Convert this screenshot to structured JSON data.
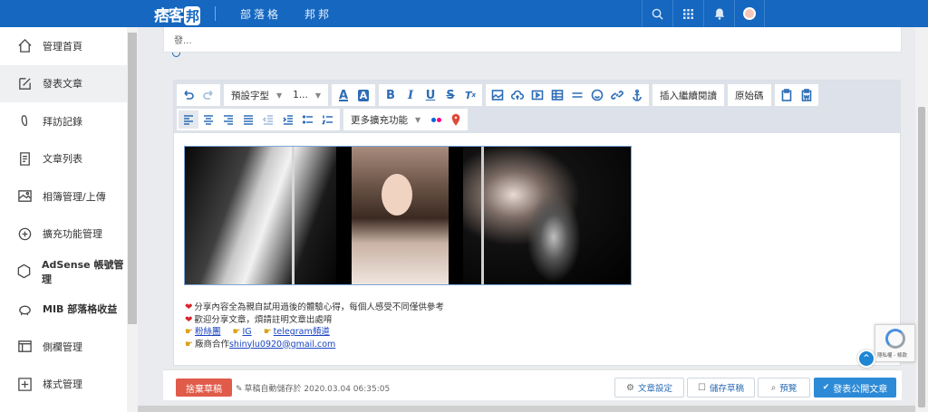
{
  "topbar": {
    "logo_text": "痞客",
    "logo_box": "邦",
    "nav": [
      "部落格",
      "邦邦"
    ],
    "icons": [
      "search-icon",
      "apps-grid-icon",
      "bell-icon",
      "avatar"
    ]
  },
  "sidebar": {
    "items": [
      {
        "label": "管理首頁",
        "icon": "home-icon"
      },
      {
        "label": "發表文章",
        "icon": "edit-icon",
        "active": true
      },
      {
        "label": "拜訪記錄",
        "icon": "footprint-icon"
      },
      {
        "label": "文章列表",
        "icon": "document-list-icon"
      },
      {
        "label": "相簿管理/上傳",
        "icon": "image-icon"
      },
      {
        "label": "擴充功能管理",
        "icon": "puzzle-icon"
      },
      {
        "label": "AdSense 帳號管理",
        "icon": "ad-icon"
      },
      {
        "label": "MIB 部落格收益",
        "icon": "piggy-bank-icon"
      },
      {
        "label": "側欄管理",
        "icon": "sidebar-layout-icon"
      },
      {
        "label": "樣式管理",
        "icon": "plus-box-icon"
      }
    ]
  },
  "summary": {
    "text": "發..."
  },
  "toolbar": {
    "font_select": "預設字型",
    "size_select": "1...",
    "insert_more": "插入繼續閱讀",
    "source_code": "原始碼",
    "more_features": "更多擴充功能",
    "colors": {
      "accent": "#2d6db5",
      "flickr_pink": "#ff0084",
      "flickr_blue": "#0063dc"
    }
  },
  "content": {
    "lines": [
      {
        "icon": "heart-icon",
        "text": "分享內容全為親自試用過後的體驗心得，每個人感受不同僅供參考"
      },
      {
        "icon": "heart-icon",
        "text": "歡迎分享文章，煩請註明文章出處唷"
      }
    ],
    "links": [
      "粉絲團",
      "IG",
      "telegram頻道"
    ],
    "contact_prefix": "廠商合作",
    "contact_email": "shinylu0920@gmail.com"
  },
  "footer": {
    "discard": "捨棄草稿",
    "autosave": "草稿自動儲存於 2020.03.04 06:35:05",
    "settings": "文章設定",
    "save_draft": "儲存草稿",
    "preview": "預覽",
    "publish": "發表公開文章"
  },
  "recaptcha": {
    "text": "隱私權 - 條款"
  },
  "colors": {
    "brand": "#1567c0",
    "discard": "#e05b4a",
    "publish": "#2d8ad6"
  }
}
